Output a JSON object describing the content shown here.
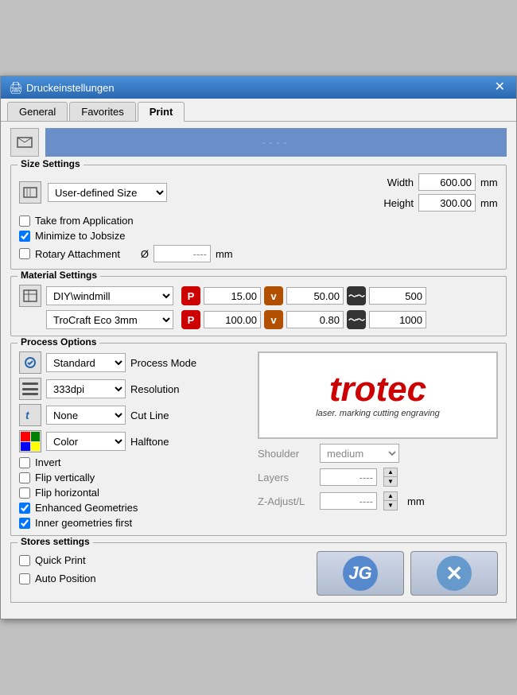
{
  "window": {
    "title": "Druckeinstellungen",
    "close_btn": "✕"
  },
  "tabs": [
    {
      "label": "General",
      "active": false
    },
    {
      "label": "Favorites",
      "active": false
    },
    {
      "label": "Print",
      "active": true
    }
  ],
  "preview": {
    "placeholder": "----"
  },
  "size_settings": {
    "title": "Size Settings",
    "dropdown_value": "User-defined Size",
    "dropdown_options": [
      "User-defined Size"
    ],
    "take_from_app_label": "Take from Application",
    "minimize_label": "Minimize to Jobsize",
    "rotary_label": "Rotary Attachment",
    "width_label": "Width",
    "height_label": "Height",
    "width_value": "600.00",
    "height_value": "300.00",
    "unit": "mm",
    "diam_symbol": "Ø",
    "diam_value": "----",
    "diam_unit": "mm"
  },
  "material_settings": {
    "title": "Material Settings",
    "dropdown1_value": "DIY\\windmill",
    "dropdown2_value": "TroCraft Eco 3mm",
    "p1_value": "15.00",
    "v1_value": "50.00",
    "m1_value": "500",
    "p2_value": "100.00",
    "v2_value": "0.80",
    "m2_value": "1000"
  },
  "process_options": {
    "title": "Process Options",
    "process_mode_label": "Process Mode",
    "resolution_label": "Resolution",
    "cut_line_label": "Cut Line",
    "halftone_label": "Halftone",
    "process_mode_value": "Standard",
    "resolution_value": "333dpi",
    "cut_line_value": "None",
    "halftone_value": "Color",
    "invert_label": "Invert",
    "flip_v_label": "Flip vertically",
    "flip_h_label": "Flip horizontal",
    "enhanced_label": "Enhanced Geometries",
    "inner_label": "Inner geometries first",
    "shoulder_label": "Shoulder",
    "shoulder_value": "medium",
    "layers_label": "Layers",
    "layers_value": "----",
    "zadjust_label": "Z-Adjust/L",
    "zadjust_value": "----",
    "zadjust_unit": "mm"
  },
  "stores_settings": {
    "title": "Stores settings",
    "quick_print_label": "Quick Print",
    "auto_position_label": "Auto Position"
  },
  "buttons": {
    "ok_symbol": "JG",
    "cancel_symbol": "✕"
  }
}
